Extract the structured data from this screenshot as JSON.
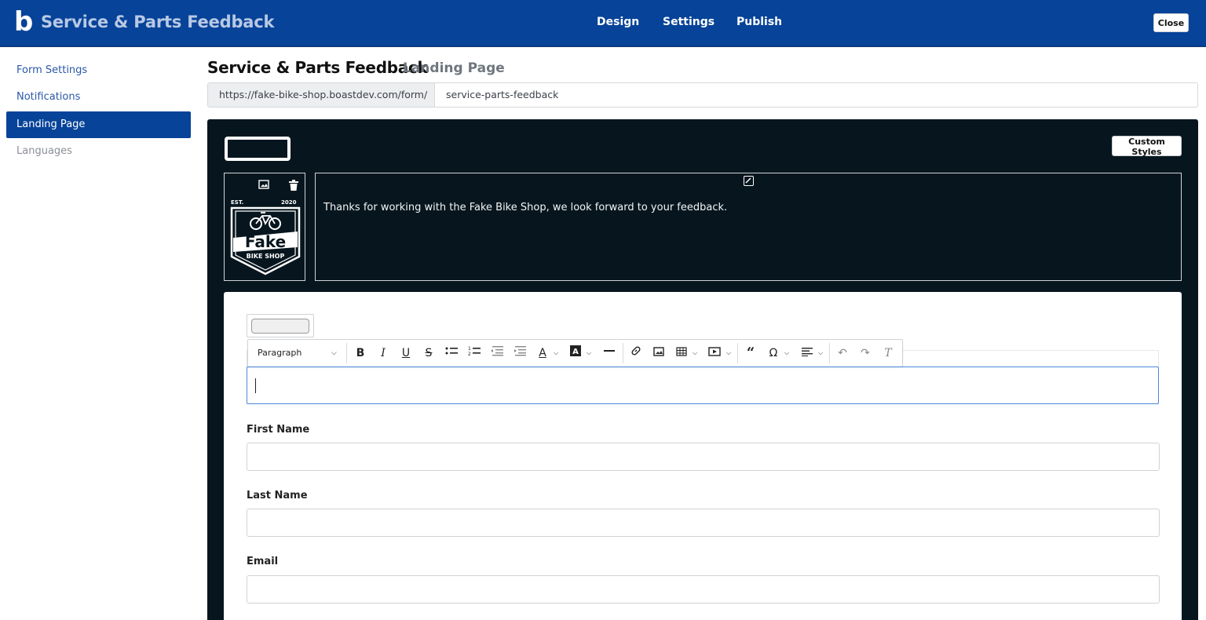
{
  "header": {
    "logo_letter": "b",
    "title": "Service & Parts Feedback",
    "nav": [
      "Design",
      "Settings",
      "Publish"
    ],
    "close_label": "Close"
  },
  "sidebar": {
    "items": [
      {
        "label": "Form Settings"
      },
      {
        "label": "Notifications"
      },
      {
        "label": "Landing Page"
      },
      {
        "label": "Languages"
      }
    ],
    "active": "Landing Page"
  },
  "main": {
    "title": "Service & Parts Feedback",
    "subtitle": "Landing Page",
    "url_prefix": "https://fake-bike-shop.boastdev.com/form/",
    "url_slug": "service-parts-feedback",
    "custom_styles_label": "Custom Styles",
    "welcome_text": "Thanks for working with the Fake Bike Shop, we look forward to your feedback.",
    "logo": {
      "est": "EST.",
      "year": "2020",
      "name": "Fake",
      "tagline": "BIKE SHOP"
    },
    "toolbar": {
      "paragraph": "Paragraph"
    },
    "fields": [
      {
        "label": "First Name",
        "value": ""
      },
      {
        "label": "Last Name",
        "value": ""
      },
      {
        "label": "Email",
        "value": ""
      }
    ]
  },
  "colors": {
    "brand": "#064399",
    "canvas": "#07161e",
    "focus": "#4a86d8"
  }
}
